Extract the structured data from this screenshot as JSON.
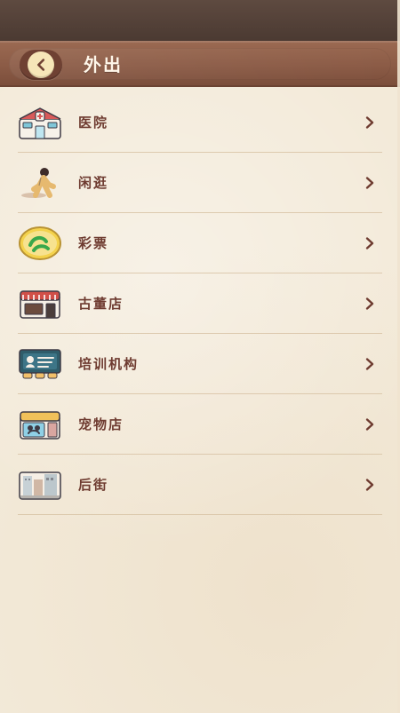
{
  "header": {
    "title": "外出"
  },
  "menu": {
    "items": [
      {
        "label": "医院",
        "icon": "hospital-icon"
      },
      {
        "label": "闲逛",
        "icon": "walking-person-icon"
      },
      {
        "label": "彩票",
        "icon": "lottery-icon"
      },
      {
        "label": "古董店",
        "icon": "antique-shop-icon"
      },
      {
        "label": "培训机构",
        "icon": "training-institution-icon"
      },
      {
        "label": "宠物店",
        "icon": "pet-shop-icon"
      },
      {
        "label": "后街",
        "icon": "back-street-icon"
      }
    ]
  },
  "colors": {
    "header_brown": "#8b5b46",
    "text_brown": "#6e3b30",
    "paper": "#f3ead9"
  }
}
